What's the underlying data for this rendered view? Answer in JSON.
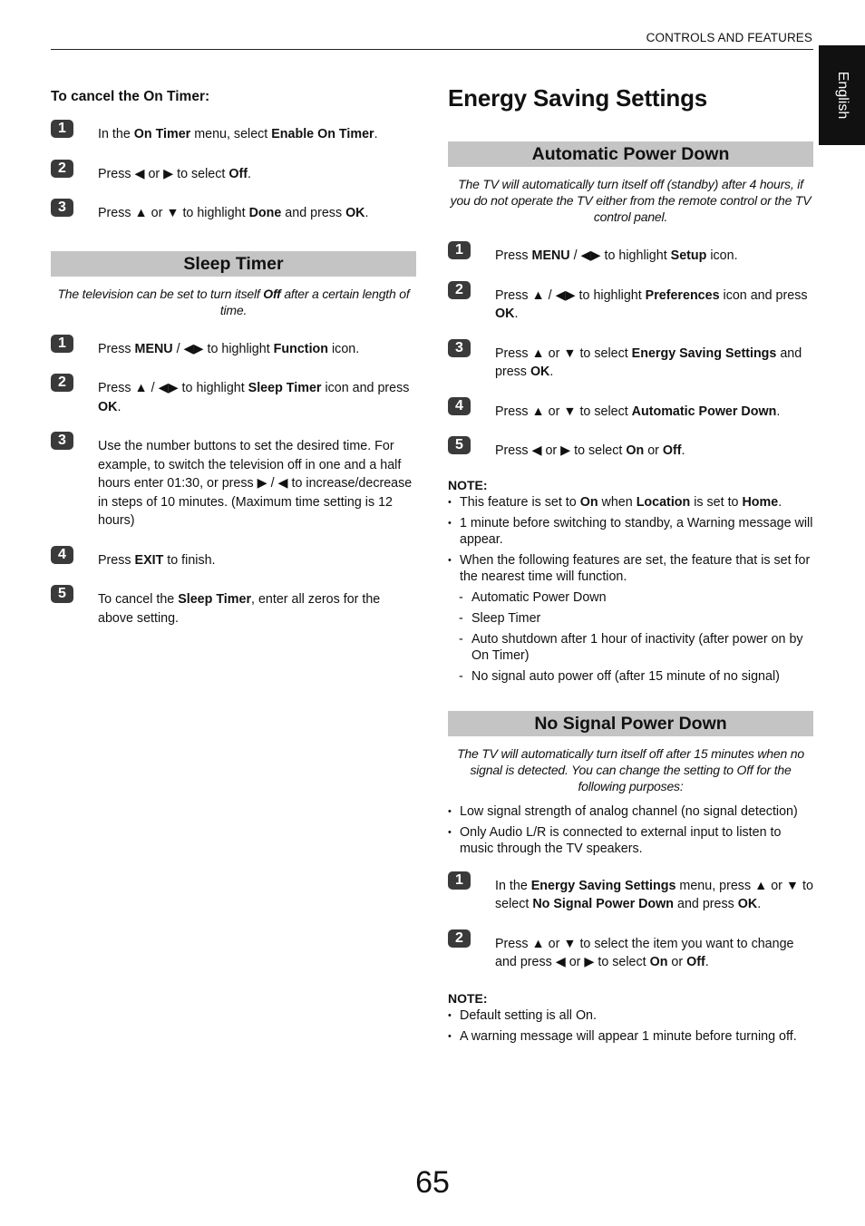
{
  "header": {
    "section_label": "CONTROLS AND FEATURES",
    "language_tab": "English"
  },
  "left": {
    "cancel_on_timer": {
      "heading": "To cancel the On Timer:",
      "steps": [
        {
          "number": "1",
          "segments": [
            [
              "In the ",
              false
            ],
            [
              "On Timer",
              true
            ],
            [
              " menu, select ",
              false
            ],
            [
              "Enable On Timer",
              true
            ],
            [
              ".",
              false
            ]
          ]
        },
        {
          "number": "2",
          "segments": [
            [
              "Press ◀ or ▶ to select ",
              false
            ],
            [
              "Off",
              true
            ],
            [
              ".",
              false
            ]
          ]
        },
        {
          "number": "3",
          "segments": [
            [
              "Press ▲ or ▼ to highlight ",
              false
            ],
            [
              "Done",
              true
            ],
            [
              " and press ",
              false
            ],
            [
              "OK",
              true
            ],
            [
              ".",
              false
            ]
          ]
        }
      ]
    },
    "sleep_timer": {
      "title": "Sleep Timer",
      "intro_segments": [
        [
          "The television can be set to turn itself ",
          false
        ],
        [
          "Off",
          true
        ],
        [
          " after a certain length of time.",
          false
        ]
      ],
      "steps": [
        {
          "number": "1",
          "segments": [
            [
              "Press ",
              false
            ],
            [
              "MENU",
              true
            ],
            [
              " / ◀▶ to highlight ",
              false
            ],
            [
              "Function",
              true
            ],
            [
              " icon.",
              false
            ]
          ]
        },
        {
          "number": "2",
          "segments": [
            [
              "Press ▲ / ◀▶ to highlight ",
              false
            ],
            [
              "Sleep Timer",
              true
            ],
            [
              " icon and press ",
              false
            ],
            [
              "OK",
              true
            ],
            [
              ".",
              false
            ]
          ]
        },
        {
          "number": "3",
          "segments": [
            [
              "Use the number buttons to set the desired time. For example, to switch the television off in one and a half hours enter 01:30, or press ▶ / ◀ to increase/decrease in steps of 10 minutes. (Maximum time setting is 12 hours)",
              false
            ]
          ]
        },
        {
          "number": "4",
          "segments": [
            [
              "Press ",
              false
            ],
            [
              "EXIT",
              true
            ],
            [
              " to finish.",
              false
            ]
          ]
        },
        {
          "number": "5",
          "segments": [
            [
              "To cancel the ",
              false
            ],
            [
              "Sleep Timer",
              true
            ],
            [
              ", enter all zeros for the above setting.",
              false
            ]
          ]
        }
      ]
    }
  },
  "right": {
    "title": "Energy Saving Settings",
    "automatic_power_down": {
      "title": "Automatic Power Down",
      "intro": "The TV will automatically turn itself off (standby) after 4 hours, if you do not operate the TV either from the remote control or the TV control panel.",
      "steps": [
        {
          "number": "1",
          "segments": [
            [
              "Press ",
              false
            ],
            [
              "MENU",
              true
            ],
            [
              " / ◀▶ to highlight ",
              false
            ],
            [
              "Setup",
              true
            ],
            [
              " icon.",
              false
            ]
          ]
        },
        {
          "number": "2",
          "segments": [
            [
              "Press ▲ / ◀▶ to highlight ",
              false
            ],
            [
              "Preferences",
              true
            ],
            [
              " icon and press ",
              false
            ],
            [
              "OK",
              true
            ],
            [
              ".",
              false
            ]
          ]
        },
        {
          "number": "3",
          "segments": [
            [
              "Press ▲ or ▼ to select ",
              false
            ],
            [
              "Energy Saving Settings",
              true
            ],
            [
              " and press ",
              false
            ],
            [
              "OK",
              true
            ],
            [
              ".",
              false
            ]
          ]
        },
        {
          "number": "4",
          "segments": [
            [
              "Press ▲ or ▼ to select ",
              false
            ],
            [
              "Automatic Power Down",
              true
            ],
            [
              ".",
              false
            ]
          ]
        },
        {
          "number": "5",
          "segments": [
            [
              "Press ◀ or ▶ to select ",
              false
            ],
            [
              "On",
              true
            ],
            [
              " or ",
              false
            ],
            [
              "Off",
              true
            ],
            [
              ".",
              false
            ]
          ]
        }
      ],
      "note_title": "NOTE:",
      "notes": [
        {
          "type": "bullet",
          "segments": [
            [
              "This feature is set to ",
              false
            ],
            [
              "On",
              true
            ],
            [
              " when ",
              false
            ],
            [
              "Location",
              true
            ],
            [
              " is set to ",
              false
            ],
            [
              "Home",
              true
            ],
            [
              ".",
              false
            ]
          ]
        },
        {
          "type": "bullet",
          "segments": [
            [
              "1 minute before switching to standby, a Warning message will appear.",
              false
            ]
          ]
        },
        {
          "type": "bullet",
          "segments": [
            [
              "When the following features are set, the feature that is set for the nearest time will function.",
              false
            ]
          ]
        },
        {
          "type": "dash",
          "segments": [
            [
              "Automatic Power Down",
              false
            ]
          ]
        },
        {
          "type": "dash",
          "segments": [
            [
              "Sleep Timer",
              false
            ]
          ]
        },
        {
          "type": "dash",
          "segments": [
            [
              "Auto shutdown after 1 hour of inactivity (after power on by On Timer)",
              false
            ]
          ]
        },
        {
          "type": "dash",
          "segments": [
            [
              "No signal auto power off (after 15 minute of no signal)",
              false
            ]
          ]
        }
      ]
    },
    "no_signal_power_down": {
      "title": "No Signal Power Down",
      "intro": "The TV will automatically turn itself off after 15 minutes when no signal is detected. You can change the setting to Off for the following purposes:",
      "purposes": [
        {
          "type": "bullet",
          "segments": [
            [
              "Low signal strength of analog channel (no signal detection)",
              false
            ]
          ]
        },
        {
          "type": "bullet",
          "segments": [
            [
              "Only Audio L/R is connected to external input to listen to music through the TV speakers.",
              false
            ]
          ]
        }
      ],
      "steps": [
        {
          "number": "1",
          "segments": [
            [
              "In the ",
              false
            ],
            [
              "Energy Saving Settings",
              true
            ],
            [
              " menu, press ▲ or ▼ to select ",
              false
            ],
            [
              "No Signal Power Down",
              true
            ],
            [
              " and press ",
              false
            ],
            [
              "OK",
              true
            ],
            [
              ".",
              false
            ]
          ]
        },
        {
          "number": "2",
          "segments": [
            [
              "Press ▲ or ▼ to select the item you want to change and press ◀ or ▶ to select ",
              false
            ],
            [
              "On",
              true
            ],
            [
              " or ",
              false
            ],
            [
              "Off",
              true
            ],
            [
              ".",
              false
            ]
          ]
        }
      ],
      "note_title": "NOTE:",
      "notes": [
        {
          "type": "bullet",
          "segments": [
            [
              "Default setting is all On.",
              false
            ]
          ]
        },
        {
          "type": "bullet",
          "segments": [
            [
              "A warning message will appear 1 minute before turning off.",
              false
            ]
          ]
        }
      ]
    }
  },
  "footer": {
    "page_number": "65"
  }
}
